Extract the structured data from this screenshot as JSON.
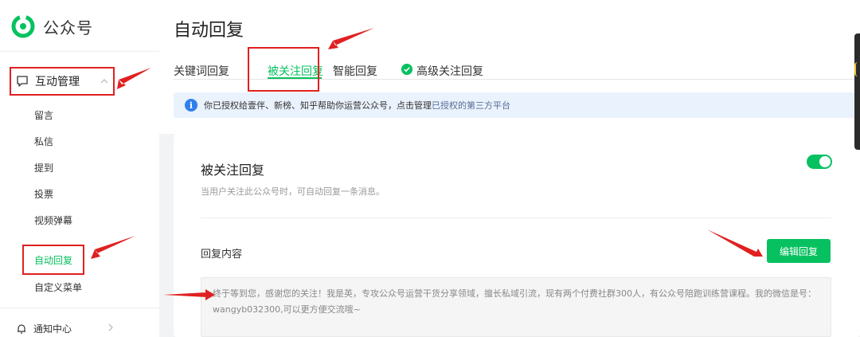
{
  "app": {
    "name": "公众号"
  },
  "sidebar": {
    "group": {
      "label": "互动管理",
      "items": [
        {
          "label": "留言"
        },
        {
          "label": "私信"
        },
        {
          "label": "提到"
        },
        {
          "label": "投票"
        },
        {
          "label": "视频弹幕"
        },
        {
          "label": "自动回复",
          "active": true
        },
        {
          "label": "自定义菜单"
        }
      ]
    },
    "next_group": {
      "label": "通知中心"
    }
  },
  "main": {
    "title": "自动回复",
    "tabs": [
      {
        "label": "关键词回复"
      },
      {
        "label": "被关注回复",
        "active": true
      },
      {
        "label": "智能回复"
      },
      {
        "label": "高级关注回复"
      }
    ],
    "notice": {
      "text": "你已授权给壹伴、新榜、知乎帮助你运营公众号，点击管理",
      "link": "已授权的第三方平台"
    },
    "card": {
      "title": "被关注回复",
      "description": "当用户关注此公众号时，可自动回复一条消息。",
      "toggle_on": true,
      "reply_label": "回复内容",
      "edit_button": "编辑回复",
      "reply_text": "终于等到您，感谢您的关注！我是英，专攻公众号运营干货分享领域，擅长私域引流，现有两个付费社群300人，有公众号陪跑训练营课程。我的微信是号：wangyb032300,可以更方便交流哦~"
    }
  },
  "colors": {
    "accent": "#07c160",
    "annotation": "#e02020",
    "notice_bg": "#eaf2fd",
    "link": "#576b95"
  }
}
